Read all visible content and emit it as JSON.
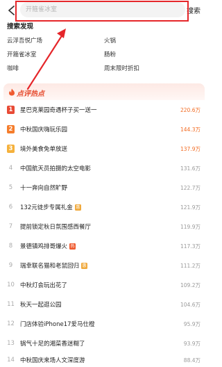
{
  "search": {
    "placeholder": "开箍雀冰室",
    "button_label": "搜索"
  },
  "discover": {
    "title": "搜索发现",
    "items": [
      "云浮吾悦广场",
      "火锅",
      "开箍雀冰室",
      "肠粉",
      "咖啡",
      "周末限时折扣"
    ]
  },
  "hot": {
    "title": "点评热点",
    "items": [
      {
        "rank": "1",
        "title": "星巴克莱园奇遇杯子买一送一",
        "value": "220.6万",
        "badge": ""
      },
      {
        "rank": "2",
        "title": "中秋国庆嗨玩乐园",
        "value": "144.3万",
        "badge": ""
      },
      {
        "rank": "3",
        "title": "境外美食免单放送",
        "value": "137.9万",
        "badge": ""
      },
      {
        "rank": "4",
        "title": "中国航天员拍摄的太空电影",
        "value": "131.6万",
        "badge": ""
      },
      {
        "rank": "5",
        "title": "十一奔向自然旷野",
        "value": "122.7万",
        "badge": ""
      },
      {
        "rank": "6",
        "title": "132元徒步专属礼金",
        "value": "121.9万",
        "badge": "惠"
      },
      {
        "rank": "7",
        "title": "提前锁定秋日氛围感西餐厅",
        "value": "119.9万",
        "badge": ""
      },
      {
        "rank": "8",
        "title": "景德镇鸡排哥爆火",
        "value": "117.3万",
        "badge": "热"
      },
      {
        "rank": "9",
        "title": "瑞幸联名猫和老鼠回归",
        "value": "111.2万",
        "badge": "惠"
      },
      {
        "rank": "10",
        "title": "中秋灯会玩出花了",
        "value": "109.2万",
        "badge": ""
      },
      {
        "rank": "11",
        "title": "秋天一起逛公园",
        "value": "104.6万",
        "badge": ""
      },
      {
        "rank": "12",
        "title": "门店体验iPhone17爱马仕橙",
        "value": "95.9万",
        "badge": ""
      },
      {
        "rank": "13",
        "title": "锅气十足的湘菜香迷糊了",
        "value": "93.9万",
        "badge": ""
      },
      {
        "rank": "14",
        "title": "中秋国庆来场人文深度游",
        "value": "88.4万",
        "badge": ""
      }
    ]
  },
  "colors": {
    "highlight": "#e5262a",
    "rank1": "#e84a35",
    "rank2": "#f57d2c",
    "rank3": "#f5b13c",
    "hot_value": "#f26b22"
  }
}
